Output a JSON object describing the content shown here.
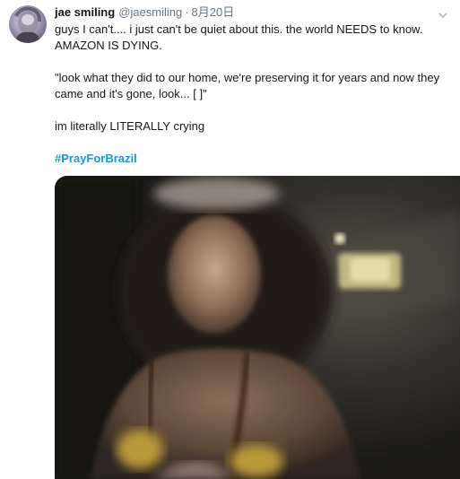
{
  "tweet": {
    "display_name": "jae smiling",
    "handle": "@jaesmiling",
    "separator": "·",
    "date": "8月20日",
    "lines": [
      "guys I can't.... i just can't be quiet about this. the world NEEDS to know.",
      "AMAZON IS DYING.",
      "\"look what they did to our home, we're preserving it for years and now they",
      "came and it's gone, look... [   ]\"",
      "im literally LITERALLY crying"
    ],
    "hashtag": "#PrayForBrazil"
  },
  "icons": {
    "avatar": "avatar-photo",
    "caret": "chevron-down-icon",
    "media": "video-still"
  },
  "colors": {
    "link": "#1b95e0",
    "secondary_text": "#657786",
    "primary_text": "#14171a"
  }
}
